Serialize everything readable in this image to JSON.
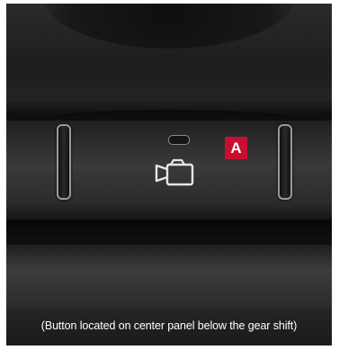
{
  "badge_label": "A",
  "caption": "(Button located on center panel below the gear shift)",
  "icon": "camera-icon",
  "colors": {
    "badge": "#c8102e",
    "panel": "#2e2e2e",
    "caption_text": "#ffffff"
  }
}
